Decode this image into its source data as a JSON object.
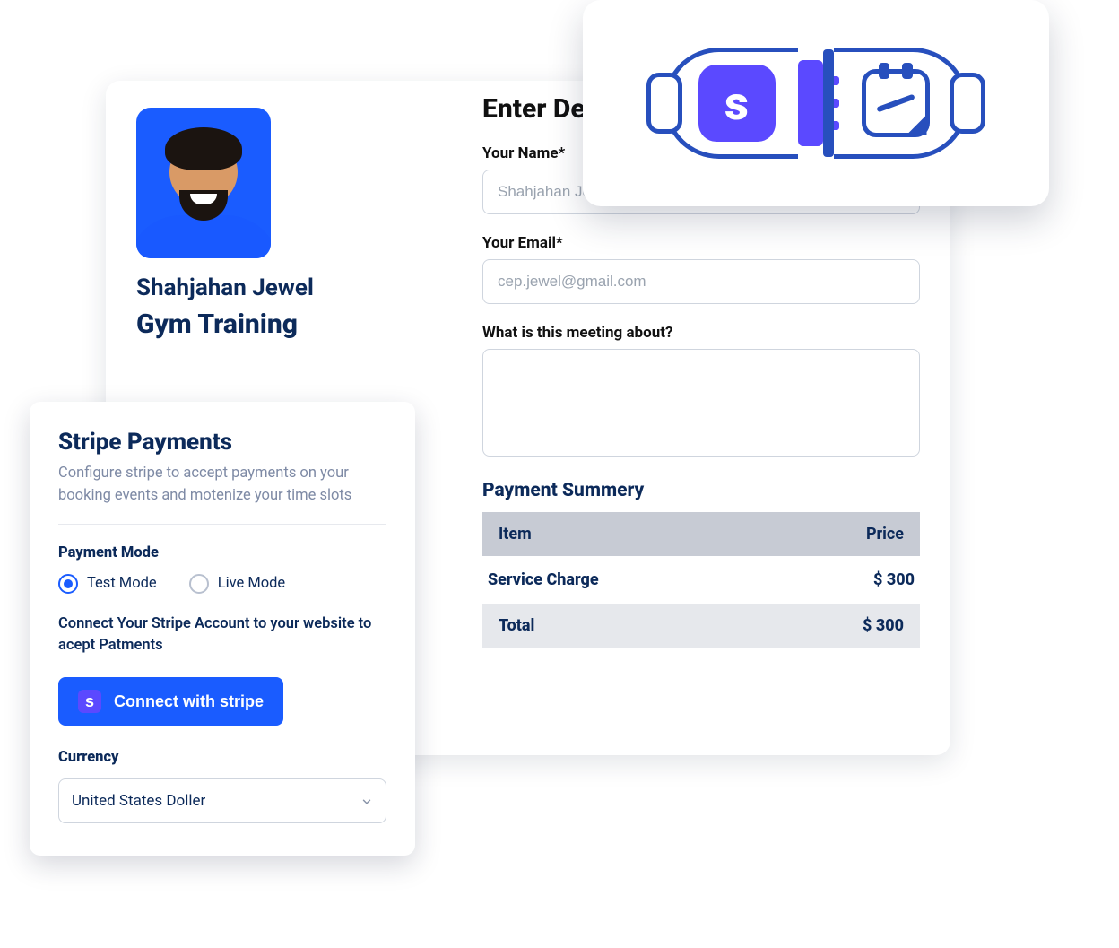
{
  "profile": {
    "name": "Shahjahan Jewel",
    "title": "Gym Training"
  },
  "form": {
    "heading": "Enter Details",
    "name_label": "Your Name*",
    "name_placeholder": "Shahjahan Jewel",
    "email_label": "Your Email*",
    "email_placeholder": "cep.jewel@gmail.com",
    "about_label": "What is this meeting about?"
  },
  "payment": {
    "heading": "Payment Summery",
    "col_item": "Item",
    "col_price": "Price",
    "charge_label": "Service Charge",
    "charge_value": "$ 300",
    "total_label": "Total",
    "total_value": "$ 300"
  },
  "stripe": {
    "title": "Stripe Payments",
    "description": "Configure stripe to accept payments on your booking events and motenize your time slots",
    "mode_label": "Payment Mode",
    "mode_test": "Test Mode",
    "mode_live": "Live Mode",
    "connect_note": "Connect Your Stripe Account to your website to acept Patments",
    "connect_button": "Connect with stripe",
    "currency_label": "Currency",
    "currency_value": "United States Doller"
  },
  "integration": {
    "stripe_glyph": "s"
  }
}
